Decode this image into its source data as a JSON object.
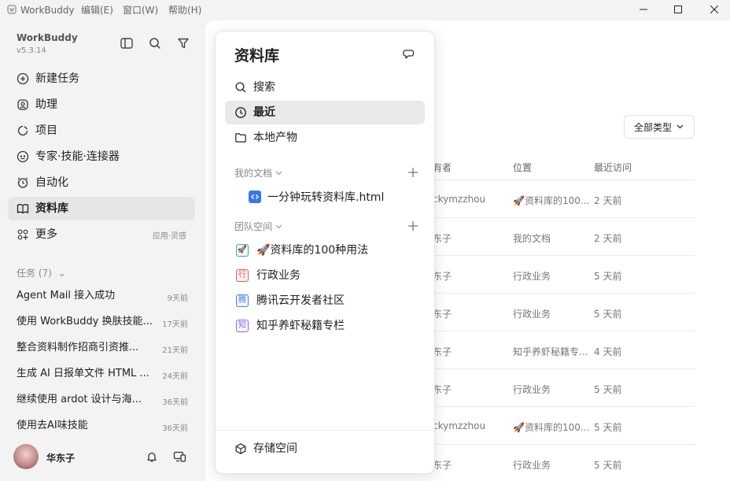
{
  "titlebar": {
    "app_name": "WorkBuddy",
    "menus": [
      "编辑(E)",
      "窗口(W)",
      "帮助(H)"
    ]
  },
  "sidebar": {
    "brand": "WorkBuddy",
    "version": "v5.3.14",
    "nav": [
      {
        "label": "新建任务",
        "icon": "plus-circle-icon"
      },
      {
        "label": "助理",
        "icon": "assistant-icon"
      },
      {
        "label": "项目",
        "icon": "project-icon"
      },
      {
        "label": "专家·技能·连接器",
        "icon": "expert-icon"
      },
      {
        "label": "自动化",
        "icon": "alarm-icon"
      },
      {
        "label": "资料库",
        "icon": "book-icon",
        "active": true
      },
      {
        "label": "更多",
        "icon": "grid-icon",
        "hint": "应用·灵感"
      }
    ],
    "tasks_header": "任务 (7)",
    "tasks": [
      {
        "title": "Agent Mail 接入成功",
        "time": "9天前"
      },
      {
        "title": "使用 WorkBuddy 换肤技能...",
        "time": "17天前"
      },
      {
        "title": "整合资料制作招商引资推...",
        "time": "21天前"
      },
      {
        "title": "生成 AI 日报单文件 HTML ...",
        "time": "24天前"
      },
      {
        "title": "继续使用 ardot 设计与海...",
        "time": "36天前"
      },
      {
        "title": "使用去AI味技能",
        "time": "36天前"
      }
    ],
    "user": {
      "name": "华东子"
    }
  },
  "main": {
    "filter_label": "全部类型",
    "columns": {
      "owner": "有者",
      "location": "位置",
      "last_visit": "最近访问"
    },
    "rows": [
      {
        "owner": "ckymzzhou",
        "location": "🚀资料库的100...",
        "time": "2 天前"
      },
      {
        "owner": "东子",
        "location": "我的文档",
        "time": "2 天前"
      },
      {
        "owner": "东子",
        "location": "行政业务",
        "time": "5 天前"
      },
      {
        "owner": "东子",
        "location": "行政业务",
        "time": "5 天前"
      },
      {
        "owner": "东子",
        "location": "知乎养虾秘籍专...",
        "time": "4 天前"
      },
      {
        "owner": "东子",
        "location": "行政业务",
        "time": "5 天前"
      },
      {
        "owner": "ckymzzhou",
        "location": "🚀资料库的100...",
        "time": "5 天前"
      },
      {
        "owner": "东子",
        "location": "行政业务",
        "time": "5 天前"
      }
    ]
  },
  "popup": {
    "title": "资料库",
    "items": [
      {
        "label": "搜索",
        "icon": "search-icon"
      },
      {
        "label": "最近",
        "icon": "clock-icon",
        "active": true
      },
      {
        "label": "本地产物",
        "icon": "folder-icon"
      }
    ],
    "my_docs_label": "我的文档",
    "my_docs": [
      {
        "label": "一分钟玩转资料库.html",
        "icon": "html-file-icon"
      }
    ],
    "team_label": "团队空间",
    "spaces": [
      {
        "label": "🚀资料库的100种用法",
        "badge": "🚀",
        "color": "#2fb89a"
      },
      {
        "label": "行政业务",
        "badge": "行",
        "color": "#e25d5d"
      },
      {
        "label": "腾讯云开发者社区",
        "badge": "腾",
        "color": "#4a7fe0"
      },
      {
        "label": "知乎养虾秘籍专栏",
        "badge": "知",
        "color": "#8a6ee0"
      }
    ],
    "storage_label": "存储空间"
  }
}
